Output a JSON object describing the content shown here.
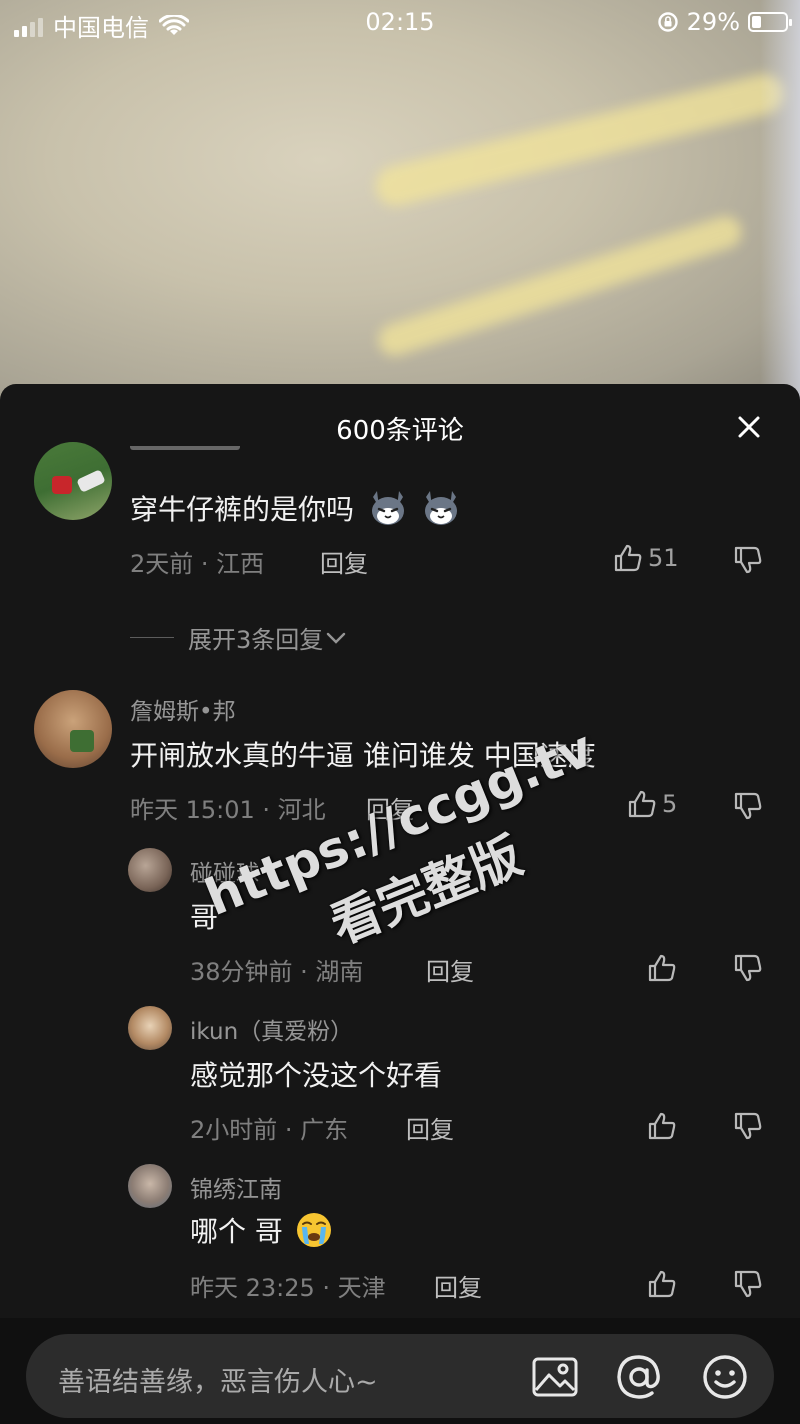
{
  "status_bar": {
    "carrier": "中国电信",
    "time": "02:15",
    "battery_percent": "29%",
    "battery_level": 0.29
  },
  "sheet": {
    "title": "600条评论",
    "close_icon": "close-icon"
  },
  "comments": [
    {
      "text": "穿牛仔裤的是你吗",
      "emojis": [
        "cat-face-icon",
        "cat-face-icon"
      ],
      "time_location": "2天前 · 江西",
      "reply_label": "回复",
      "likes": "51"
    },
    {
      "name": "詹姆斯•邦",
      "text": "开闸放水真的牛逼   谁问谁发  中国速度",
      "time_location": "昨天 15:01 · 河北",
      "reply_label": "回复",
      "likes": "5"
    }
  ],
  "expand_replies": "展开3条回复",
  "replies": [
    {
      "name": "碰碰球",
      "text": "哥",
      "time_location": "38分钟前 · 湖南",
      "reply_label": "回复"
    },
    {
      "name": "ikun（真爱粉）",
      "text": "感觉那个没这个好看",
      "time_location": "2小时前 · 广东",
      "reply_label": "回复"
    },
    {
      "name": "锦绣江南",
      "text": "哪个 哥",
      "emoji": "crying-face-icon",
      "time_location": "昨天 23:25 · 天津",
      "reply_label": "回复"
    }
  ],
  "watermark": {
    "line1": "https://ccgg.tv",
    "line2": "看完整版"
  },
  "input": {
    "placeholder": "善语结善缘，恶言伤人心~",
    "icons": [
      "image-icon",
      "at-icon",
      "emoji-icon"
    ]
  }
}
